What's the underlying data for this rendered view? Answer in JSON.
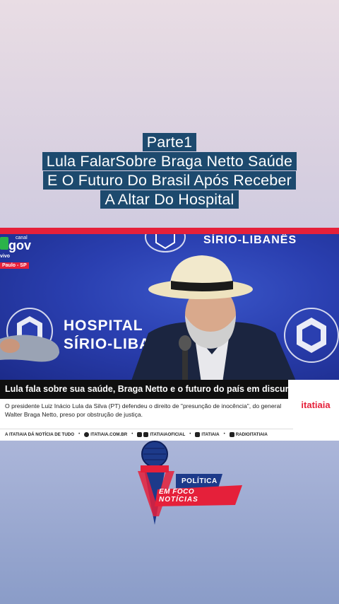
{
  "title_lines": [
    "Parte1",
    "Lula FalarSobre Braga Netto Saúde",
    "E O Futuro Do Brasil Após Receber",
    "A Altar Do Hospital"
  ],
  "broadcast": {
    "gov_label_small": "canal",
    "gov_label": "gov",
    "live_label": "vivo",
    "location_tag": "Paulo - SP",
    "backdrop_top": "SÍRIO-LIBANÊS",
    "backdrop_hospital_line1": "HOSPITAL",
    "backdrop_hospital_line2": "SÍRIO-LIBA"
  },
  "lower_third": {
    "headline": "Lula fala sobre sua saúde, Braga Netto e o futuro do país em discurso",
    "subtext": "O presidente Luiz Inácio Lula da Silva (PT) defendeu o direito de \"presunção de inocência\", do general Walter Braga Netto, preso por obstrução de justiça.",
    "brand": "itatiaia",
    "footer": {
      "tagline": "A ITATIAIA DÁ NOTÍCIA DE TUDO",
      "website": "ITATIAIA.COM.BR",
      "youtube_instagram": "ITATIAIAOFICIAL",
      "twitter": "ITATIAIA",
      "facebook": "RADIOITATIAIA"
    }
  },
  "channel_logo": {
    "line1": "POLÍTICA",
    "line2": "EM FOCO",
    "line3": "NOTÍCIAS"
  },
  "colors": {
    "title_bg": "#1d4a6e",
    "accent_red": "#e5203a",
    "backdrop_blue": "#2a3fb0"
  }
}
